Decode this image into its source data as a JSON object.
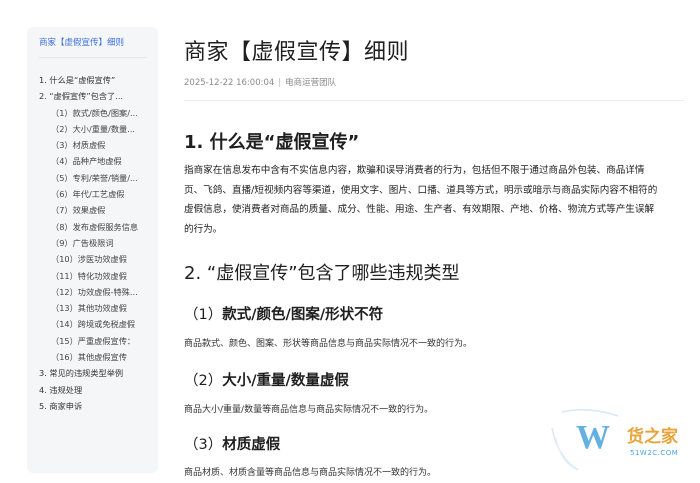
{
  "sidebar": {
    "title": "商家【虚假宣传】细则",
    "items": [
      {
        "label": "1. 什么是“虚假宣传”",
        "level": 1
      },
      {
        "label": "2. “虚假宣传”包含了...",
        "level": 1
      },
      {
        "label": "（1）款式/颜色/图案/...",
        "level": 2
      },
      {
        "label": "（2）大小/重量/数量...",
        "level": 2
      },
      {
        "label": "（3）材质虚假",
        "level": 2
      },
      {
        "label": "（4）品种产地虚假",
        "level": 2
      },
      {
        "label": "（5）专利/荣誉/销量/...",
        "level": 2
      },
      {
        "label": "（6）年代/工艺虚假",
        "level": 2
      },
      {
        "label": "（7）效果虚假",
        "level": 2
      },
      {
        "label": "（8）发布虚假服务信息",
        "level": 2
      },
      {
        "label": "（9）广告极限词",
        "level": 2
      },
      {
        "label": "（10）涉医功效虚假",
        "level": 2
      },
      {
        "label": "（11）特化功效虚假",
        "level": 2
      },
      {
        "label": "（12）功效虚假-特殊...",
        "level": 2
      },
      {
        "label": "（13）其他功效虚假",
        "level": 2
      },
      {
        "label": "（14）跨境或免税虚假",
        "level": 2
      },
      {
        "label": "（15）严重虚假宣传：",
        "level": 2
      },
      {
        "label": "（16）其他虚假宣传",
        "level": 2
      },
      {
        "label": "3. 常见的违规类型举例",
        "level": 1
      },
      {
        "label": "4. 违规处理",
        "level": 1
      },
      {
        "label": "5. 商家申诉",
        "level": 1
      }
    ]
  },
  "article": {
    "title": "商家【虚假宣传】细则",
    "date": "2025-12-22 16:00:04",
    "separator": "|",
    "author": "电商运营团队",
    "section1_title": "1. 什么是“虚假宣传”",
    "section1_body": "指商家在信息发布中含有不实信息内容，欺骗和误导消费者的行为，包括但不限于通过商品外包装、商品详情页、飞鸽、直播/短视频内容等渠道，使用文字、图片、口播、道具等方式，明示或暗示与商品实际内容不相符的虚假信息，使消费者对商品的质量、成分、性能、用途、生产者、有效期限、产地、价格、物流方式等产生误解的行为。",
    "section2_title": "2. “虚假宣传”包含了哪些违规类型",
    "subsections": [
      {
        "num": "（1）",
        "title": "款式/颜色/图案/形状不符",
        "desc": "商品款式、颜色、图案、形状等商品信息与商品实际情况不一致的行为。"
      },
      {
        "num": "（2）",
        "title": "大小/重量/数量虚假",
        "desc": "商品大小/重量/数量等商品信息与商品实际情况不一致的行为。"
      },
      {
        "num": "（3）",
        "title": "材质虚假",
        "desc": "商品材质、材质含量等商品信息与商品实际情况不一致的行为。"
      }
    ]
  },
  "watermark": {
    "text": "货之家",
    "url": "51W2C.COM"
  },
  "colors": {
    "accent": "#3b6de0",
    "sidebar_bg": "#f5f6f8",
    "watermark_orange": "#e8a43a",
    "watermark_blue": "#4aa3df"
  }
}
